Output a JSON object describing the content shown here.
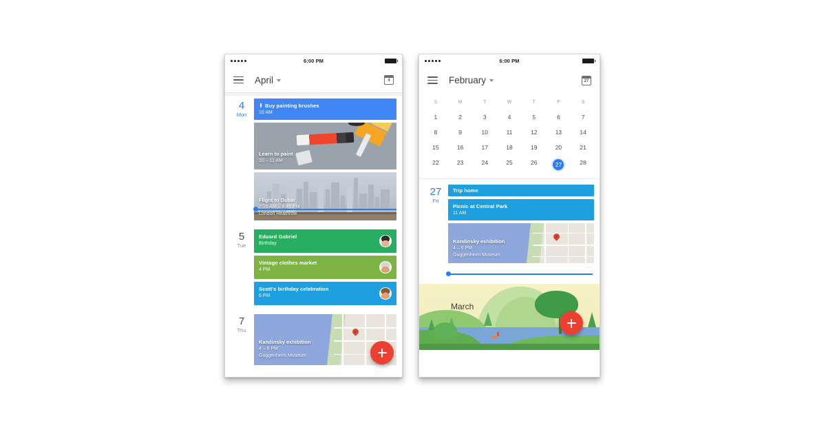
{
  "colors": {
    "accent_blue": "#2a7bf6",
    "chip_blue": "#4285f4",
    "chip_cyan": "#1e9fe0",
    "chip_green": "#27ae60",
    "chip_olive": "#7cb342",
    "fab_red": "#ec4033",
    "page_bg": "#ffffff"
  },
  "left_phone": {
    "status_bar": {
      "time": "6:00 PM",
      "signal_dots": 5,
      "battery_icon": "battery-full-icon"
    },
    "app_bar": {
      "menu_icon": "hamburger-menu-icon",
      "title": "April",
      "dropdown_icon": "caret-down-icon",
      "calendar_icon": "calendar-today-icon",
      "calendar_icon_date": "4"
    },
    "days": [
      {
        "number": "4",
        "weekday": "Mon",
        "is_today": true,
        "events": [
          {
            "kind": "chip",
            "color": "#4285f4",
            "icon": "paintbrush-icon",
            "title": "Buy painting brushes",
            "subtitle": "10 AM"
          },
          {
            "kind": "image",
            "image": "paint-tubes-photo",
            "title": "Learn to paint",
            "subtitle": "10 – 11 AM",
            "subtitle2": ""
          },
          {
            "kind": "image",
            "image": "dubai-skyline-photo",
            "title": "Flight to Dubai",
            "subtitle": "7:15 AM – 8:45 PM",
            "subtitle2": "London Heathrow"
          }
        ]
      },
      {
        "number": "5",
        "weekday": "Tue",
        "is_today": false,
        "events": [
          {
            "kind": "chip",
            "color": "#27ae60",
            "title": "Eduard Gabriel",
            "subtitle": "Birthday",
            "avatar": "contact-avatar-eduard"
          },
          {
            "kind": "chip",
            "color": "#7cb342",
            "title": "Vintage clothes market",
            "subtitle": "4 PM",
            "avatar": "contact-avatar-vintage"
          },
          {
            "kind": "chip",
            "color": "#1e9fe0",
            "title": "Scott's birthday celebration",
            "subtitle": "6 PM",
            "avatar": "contact-avatar-scott"
          }
        ]
      },
      {
        "number": "7",
        "weekday": "Thu",
        "is_today": false,
        "events": [
          {
            "kind": "image",
            "image": "map-guggenheim",
            "title": "Kandinsky exhibition",
            "subtitle": "4 – 6 PM",
            "subtitle2": "Guggenheim Museum"
          }
        ]
      }
    ],
    "now_indicator": {
      "name": "current-time-line",
      "visible": true
    },
    "fab": {
      "icon": "plus-icon",
      "label": "Create event"
    }
  },
  "right_phone": {
    "status_bar": {
      "time": "6:00 PM",
      "signal_dots": 5,
      "battery_icon": "battery-full-icon"
    },
    "app_bar": {
      "menu_icon": "hamburger-menu-icon",
      "title": "February",
      "dropdown_icon": "caret-down-icon",
      "calendar_icon": "calendar-today-icon",
      "calendar_icon_date": "27"
    },
    "month_grid": {
      "weekday_headers": [
        "S",
        "M",
        "T",
        "W",
        "T",
        "F",
        "S"
      ],
      "weeks": [
        [
          "1",
          "2",
          "3",
          "4",
          "5",
          "6",
          "7"
        ],
        [
          "8",
          "9",
          "10",
          "11",
          "12",
          "13",
          "14"
        ],
        [
          "15",
          "16",
          "17",
          "18",
          "19",
          "20",
          "21"
        ],
        [
          "22",
          "23",
          "24",
          "25",
          "26",
          "27",
          "28"
        ]
      ],
      "selected_day": "27"
    },
    "day": {
      "number": "27",
      "weekday": "Fri",
      "is_today": true,
      "events": [
        {
          "kind": "chip",
          "color": "#1e9fe0",
          "title": "Trip home",
          "subtitle": ""
        },
        {
          "kind": "chip",
          "color": "#1e9fe0",
          "title": "Picnic at Central Park",
          "subtitle": "11 AM"
        },
        {
          "kind": "image",
          "image": "map-guggenheim",
          "title": "Kandinsky exhibition",
          "subtitle": "4 – 6 PM",
          "subtitle2": "Guggenheim Museum"
        }
      ]
    },
    "now_indicator": {
      "name": "current-time-line",
      "visible": true
    },
    "month_banner": {
      "label": "March",
      "illustration": "spring-landscape-river-illustration"
    },
    "fab": {
      "icon": "plus-icon",
      "label": "Create event"
    }
  }
}
